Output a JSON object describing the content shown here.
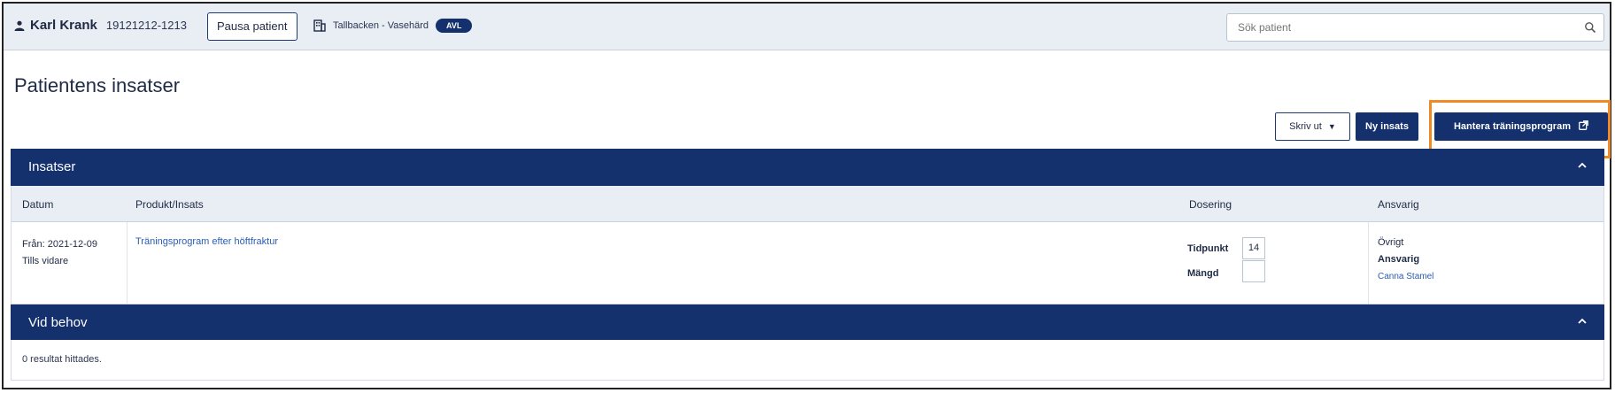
{
  "header": {
    "patient_name": "Karl Krank",
    "personal_number": "19121212-1213",
    "pause_button": "Pausa patient",
    "unit_name": "Tallbacken - Vasehärd",
    "unit_badge": "AVL",
    "search_placeholder": "Sök patient"
  },
  "page": {
    "title": "Patientens insatser"
  },
  "toolbar": {
    "print_label": "Skriv ut",
    "new_label": "Ny insats",
    "manage_label": "Hantera träningsprogram"
  },
  "insatser": {
    "title": "Insatser",
    "columns": {
      "datum": "Datum",
      "produkt": "Produkt/Insats",
      "dosering": "Dosering",
      "ansvarig": "Ansvarig"
    },
    "rows": [
      {
        "from": "Från: 2021-12-09",
        "until": "Tills vidare",
        "product": "Träningsprogram efter höftfraktur",
        "tidpunkt_label": "Tidpunkt",
        "tidpunkt_value": "14",
        "mangd_label": "Mängd",
        "mangd_value": "",
        "ansvarig_title": "Övrigt",
        "ansvarig_label": "Ansvarig",
        "ansvarig_name": "Canna Stamel"
      }
    ]
  },
  "vid_behov": {
    "title": "Vid behov",
    "empty_text": "0 resultat hittades."
  },
  "colors": {
    "primary": "#14306d",
    "highlight": "#f08a24",
    "link": "#2a5db0"
  }
}
